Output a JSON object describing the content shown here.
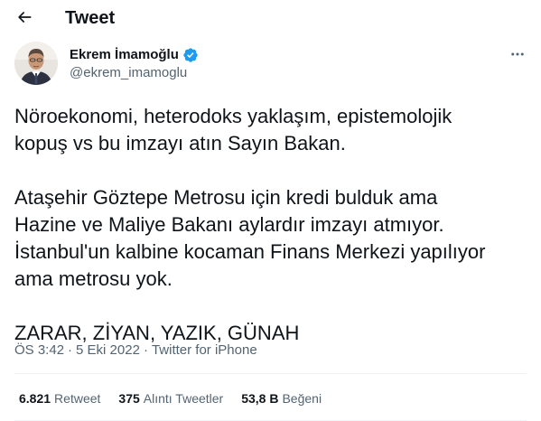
{
  "header": {
    "back_icon": "arrow-left-icon",
    "title": "Tweet"
  },
  "author": {
    "display_name": "Ekrem İmamoğlu",
    "handle": "@ekrem_imamoglu",
    "verified_icon": "verified-badge-icon",
    "verified_color": "#1d9bf0"
  },
  "tweet": {
    "paragraphs": [
      "Nöroekonomi, heterodoks yaklaşım, epistemolojik\nkopuş vs bu imzayı atın Sayın Bakan.",
      "Ataşehir Göztepe Metrosu için kredi bulduk ama\nHazine ve Maliye Bakanı aylardır imzayı atmıyor.\nİstanbul'un kalbine kocaman Finans Merkezi yapılıyor\nama metrosu yok.",
      "ZARAR, ZİYAN, YAZIK, GÜNAH"
    ],
    "time": "ÖS 3:42",
    "separator": "·",
    "date": "5 Eki 2022",
    "source": "Twitter for iPhone"
  },
  "stats": {
    "retweets_count": "6.821",
    "retweets_label": "Retweet",
    "quotes_count": "375",
    "quotes_label": "Alıntı Tweetler",
    "likes_count": "53,8 B",
    "likes_label": "Beğeni"
  },
  "more_icon": "more-horizontal-icon",
  "colors": {
    "text": "#0f1419",
    "secondary": "#536471",
    "divider": "#eff3f4"
  }
}
